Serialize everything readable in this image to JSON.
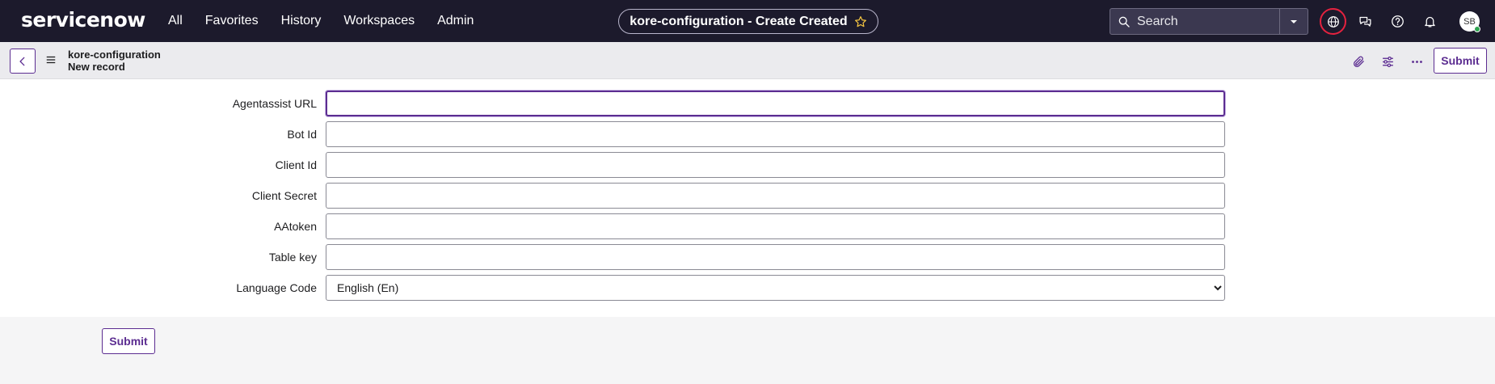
{
  "app": {
    "logo": "servicenow"
  },
  "topnav": {
    "items": [
      "All",
      "Favorites",
      "History",
      "Workspaces",
      "Admin"
    ],
    "page_title": "kore-configuration - Create Created",
    "search_placeholder": "Search",
    "avatar_initials": "SB"
  },
  "record": {
    "table": "kore-configuration",
    "subtitle": "New record",
    "submit_label": "Submit"
  },
  "form": {
    "fields": [
      {
        "label": "Agentassist URL",
        "value": ""
      },
      {
        "label": "Bot Id",
        "value": ""
      },
      {
        "label": "Client Id",
        "value": ""
      },
      {
        "label": "Client Secret",
        "value": ""
      },
      {
        "label": "AAtoken",
        "value": ""
      },
      {
        "label": "Table key",
        "value": ""
      }
    ],
    "language_label": "Language Code",
    "language_selected": "English (En)"
  },
  "footer": {
    "submit_label": "Submit"
  },
  "colors": {
    "nav_bg": "#1c1a2c",
    "accent": "#5c2d91",
    "highlight_ring": "#e4223f",
    "presence": "#2ea34f"
  }
}
